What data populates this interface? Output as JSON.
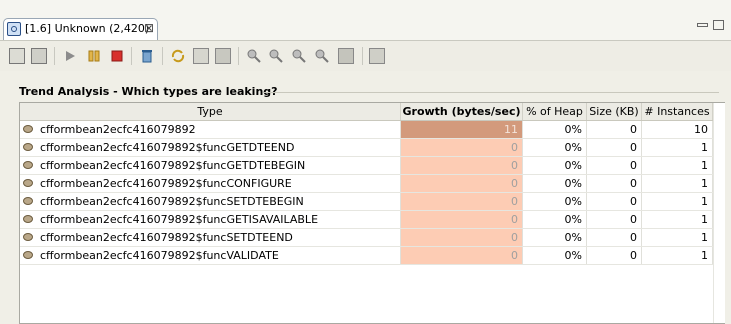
{
  "tab": {
    "title": "[1.6] Unknown (2,420)",
    "close_glyph": "⊠"
  },
  "window_controls": [
    "minimize-icon",
    "maximize-icon"
  ],
  "toolbar": {
    "icons": [
      "export-icon",
      "print-icon",
      "resume-icon",
      "pause-icon",
      "stop-icon",
      "garbage-collect-icon",
      "refresh-icon",
      "settings-icon",
      "snapshot-icon",
      "find-instances-icon",
      "find-referrers-icon",
      "find-path-icon",
      "find-1to1-icon",
      "compare-icon",
      "report-icon"
    ]
  },
  "section": {
    "title": "Trend Analysis - Which types are leaking?"
  },
  "table": {
    "headers": {
      "type": "Type",
      "growth": "Growth (bytes/sec)",
      "heap": "% of Heap",
      "size": "Size (KB)",
      "instances": "# Instances"
    },
    "rows": [
      {
        "type": "cfformbean2ecfc416079892",
        "growth": "11",
        "heap": "0%",
        "size": "0",
        "instances": "10"
      },
      {
        "type": "cfformbean2ecfc416079892$funcGETDTEEND",
        "growth": "0",
        "heap": "0%",
        "size": "0",
        "instances": "1"
      },
      {
        "type": "cfformbean2ecfc416079892$funcGETDTEBEGIN",
        "growth": "0",
        "heap": "0%",
        "size": "0",
        "instances": "1"
      },
      {
        "type": "cfformbean2ecfc416079892$funcCONFIGURE",
        "growth": "0",
        "heap": "0%",
        "size": "0",
        "instances": "1"
      },
      {
        "type": "cfformbean2ecfc416079892$funcSETDTEBEGIN",
        "growth": "0",
        "heap": "0%",
        "size": "0",
        "instances": "1"
      },
      {
        "type": "cfformbean2ecfc416079892$funcGETISAVAILABLE",
        "growth": "0",
        "heap": "0%",
        "size": "0",
        "instances": "1"
      },
      {
        "type": "cfformbean2ecfc416079892$funcSETDTEEND",
        "growth": "0",
        "heap": "0%",
        "size": "0",
        "instances": "1"
      },
      {
        "type": "cfformbean2ecfc416079892$funcVALIDATE",
        "growth": "0",
        "heap": "0%",
        "size": "0",
        "instances": "1"
      }
    ]
  },
  "colors": {
    "growth_high": "#d39a7c",
    "growth_low": "#fdccb4",
    "selection_row_text": "#000000"
  }
}
